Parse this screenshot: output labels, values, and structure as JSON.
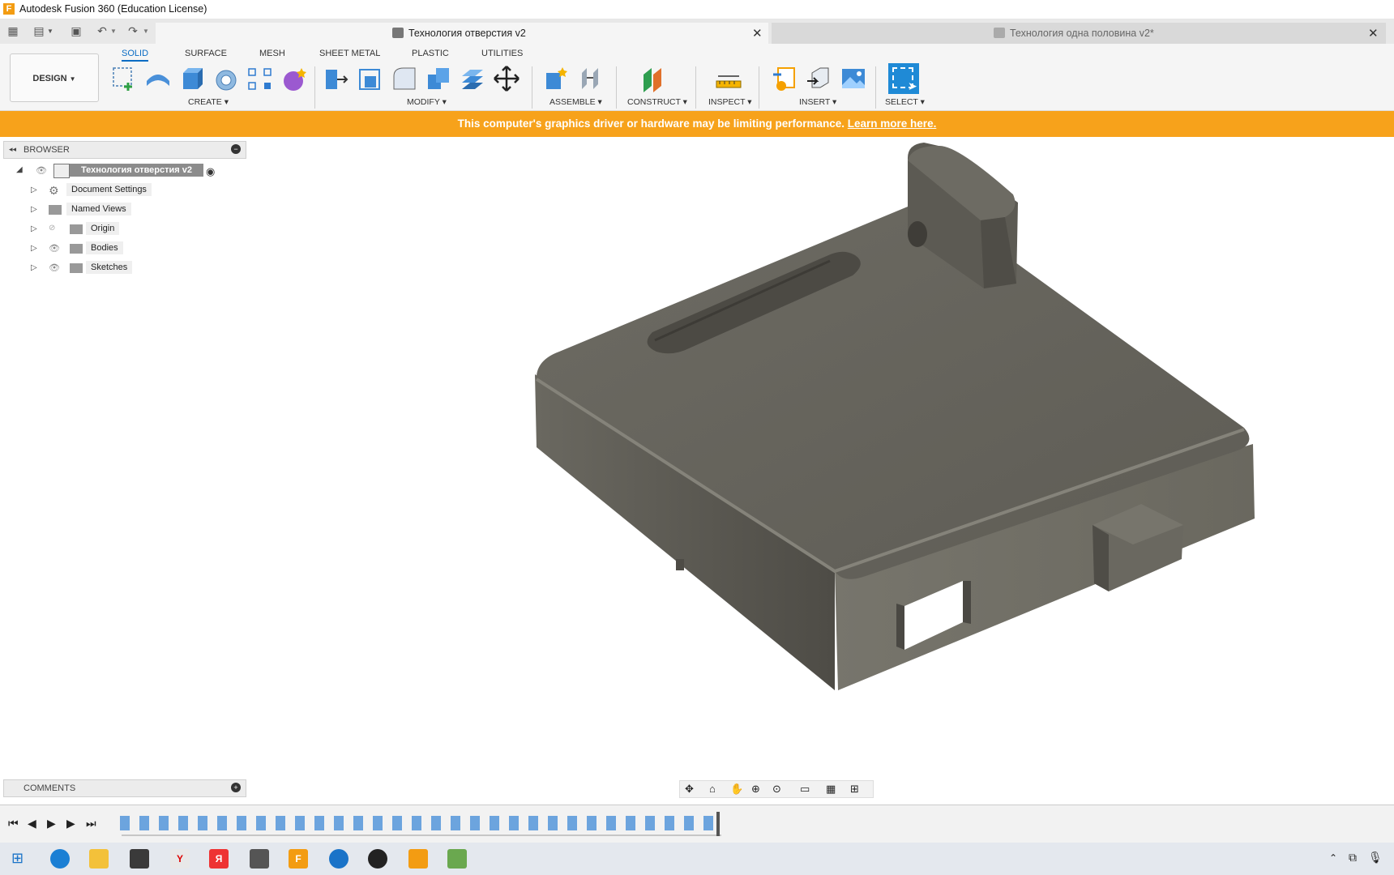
{
  "window": {
    "app_title": "Autodesk Fusion 360 (Education License)",
    "logo_letter": "F"
  },
  "tabs": {
    "active": "Технология отверстия v2",
    "inactive": "Технология одна половина v2*"
  },
  "ribbon": {
    "workspace": "DESIGN",
    "tabs": [
      "SOLID",
      "SURFACE",
      "MESH",
      "SHEET METAL",
      "PLASTIC",
      "UTILITIES"
    ],
    "groups": [
      "CREATE",
      "MODIFY",
      "ASSEMBLE",
      "CONSTRUCT",
      "INSPECT",
      "INSERT",
      "SELECT"
    ]
  },
  "warning": {
    "text": "This computer's graphics driver or hardware may be limiting performance.",
    "link": "Learn more here."
  },
  "browser": {
    "title": "BROWSER",
    "root": "Технология отверстия v2",
    "items": [
      "Document Settings",
      "Named Views",
      "Origin",
      "Bodies",
      "Sketches"
    ]
  },
  "comments": {
    "title": "COMMENTS"
  },
  "colors": {
    "accent": "#0a6cc4",
    "warning": "#f7a21b",
    "model": "#6e6c64"
  }
}
